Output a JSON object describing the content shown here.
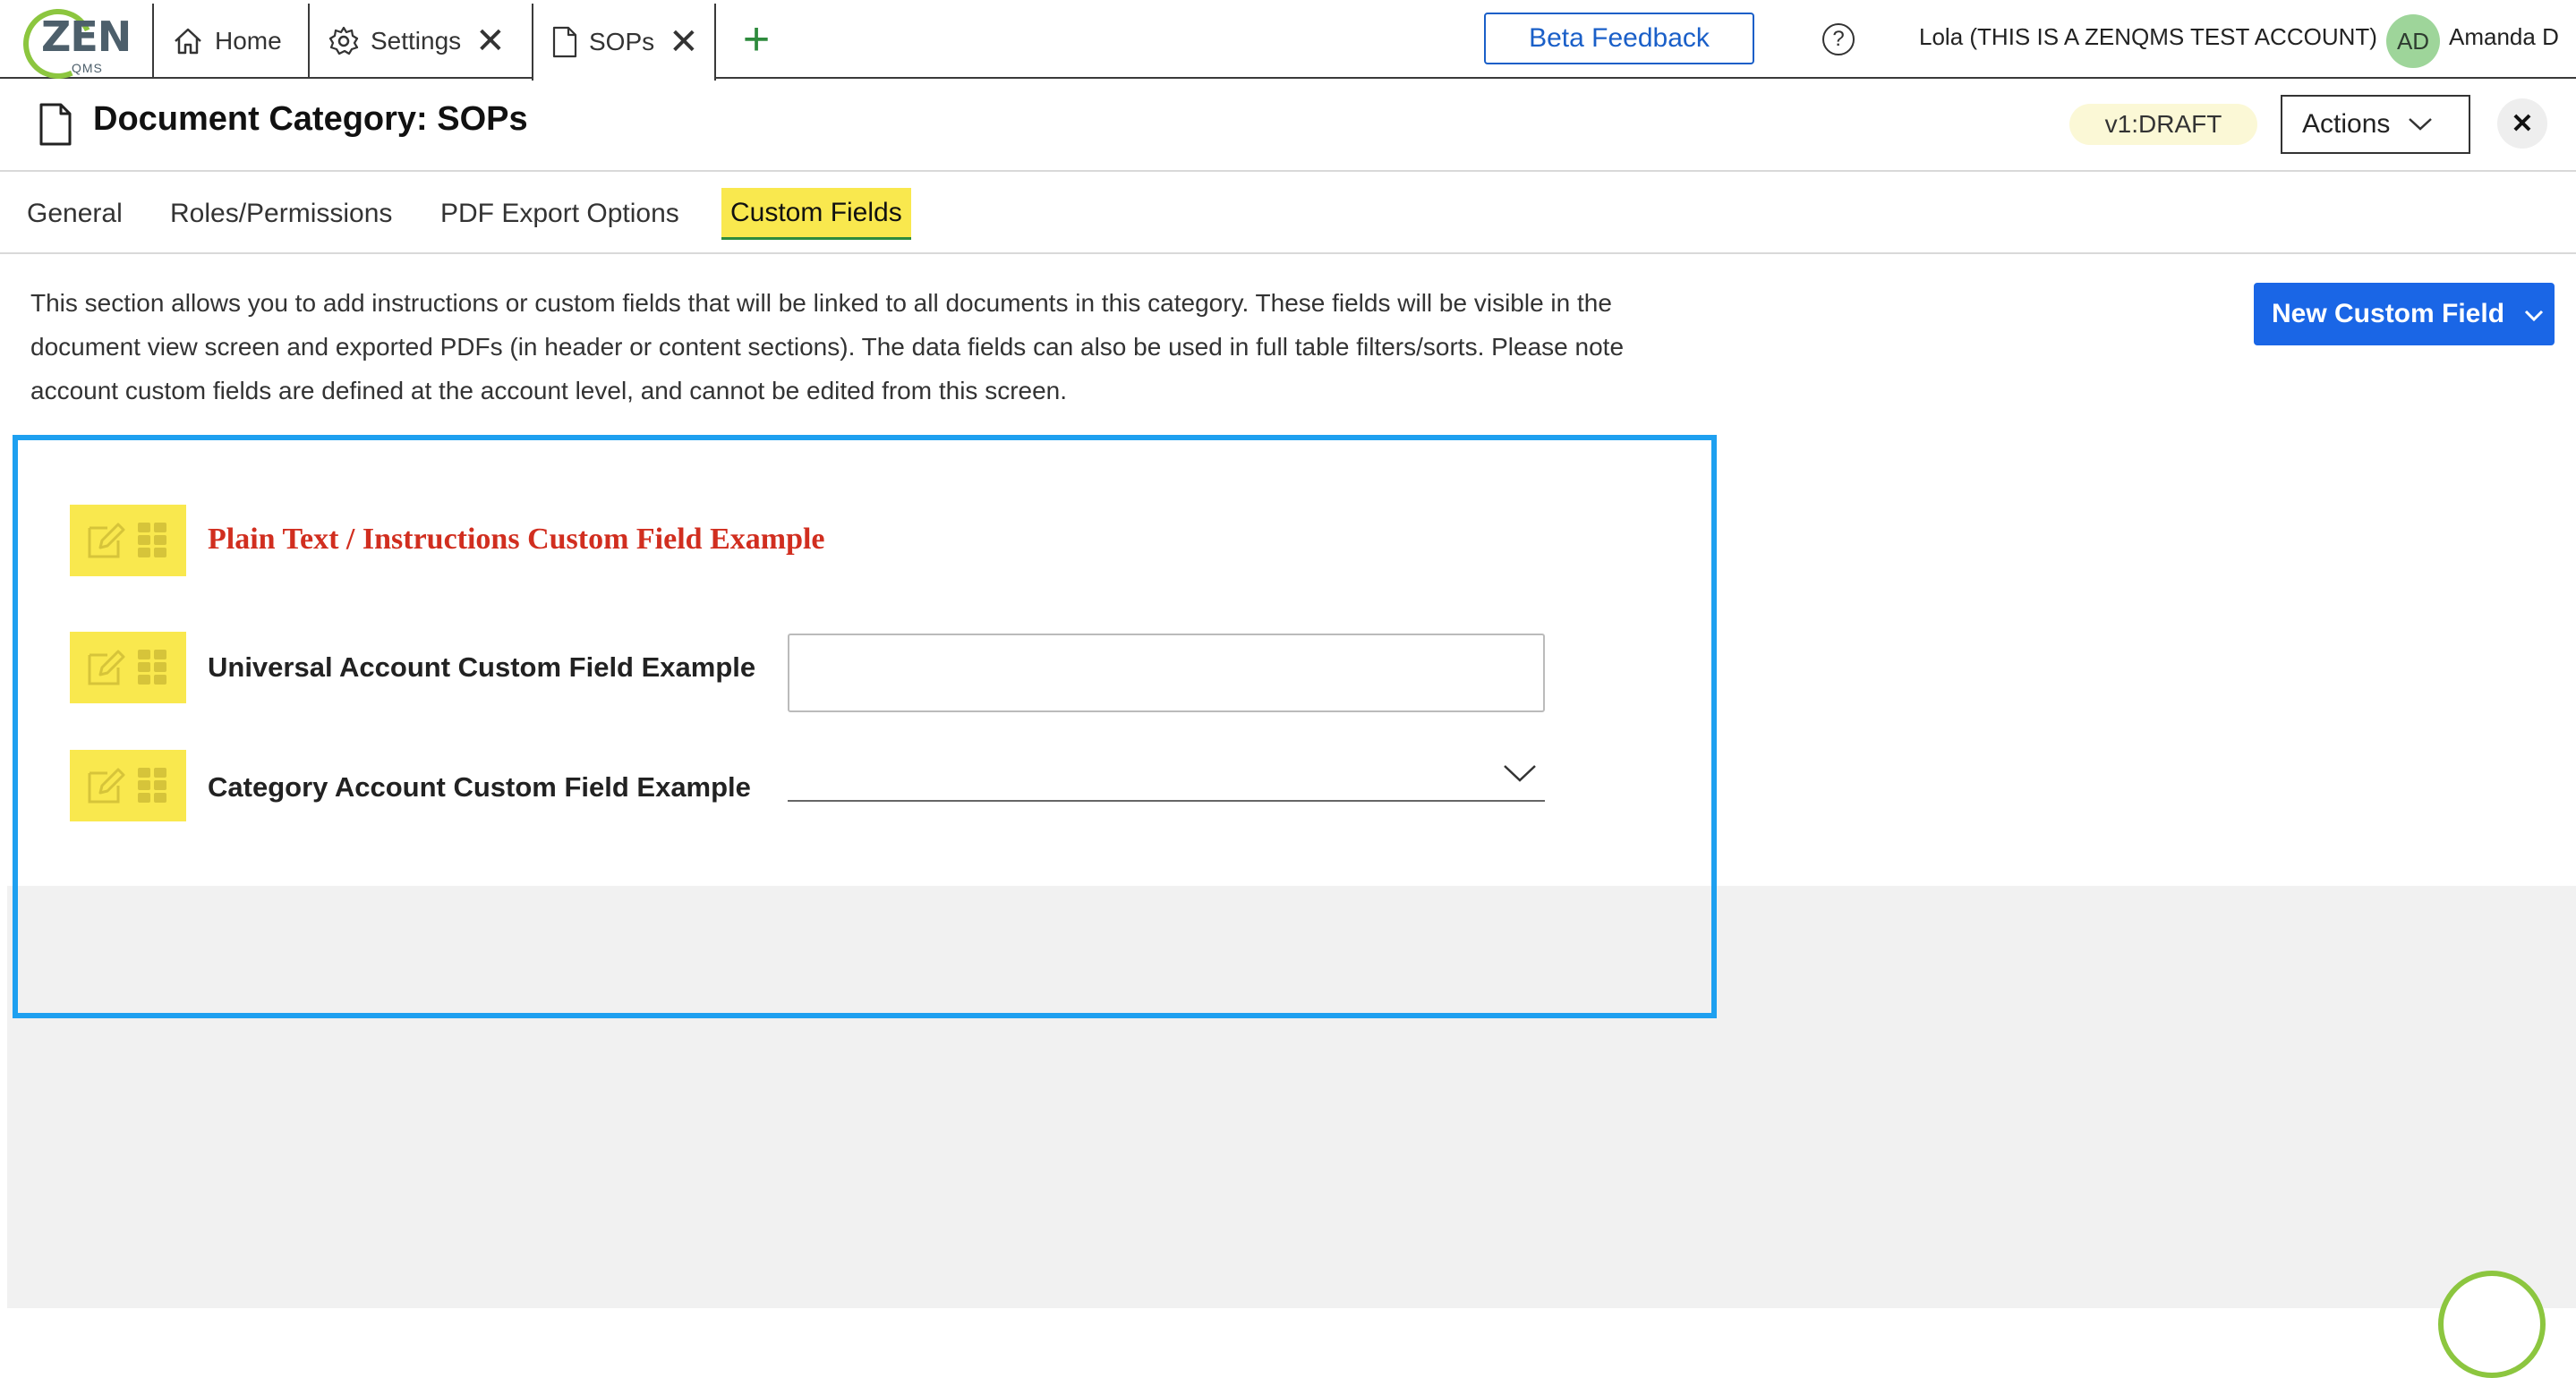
{
  "top_bar": {
    "logo_text": "ZEN",
    "logo_sub": "QMS",
    "tabs": [
      {
        "label": "Home",
        "icon": "home-icon"
      },
      {
        "label": "Settings",
        "icon": "gear-icon",
        "closable": true
      },
      {
        "label": "SOPs",
        "icon": "document-icon",
        "closable": true
      }
    ],
    "add_tab_symbol": "+",
    "close_symbol": "✕",
    "beta_feedback_label": "Beta Feedback",
    "help_symbol": "?",
    "account_name": "Lola (THIS IS A ZENQMS TEST ACCOUNT)",
    "avatar_initials": "AD",
    "user_name": "Amanda D"
  },
  "header": {
    "title": "Document Category: SOPs",
    "version_badge": "v1:DRAFT",
    "actions_label": "Actions",
    "close_symbol": "✕"
  },
  "sub_tabs": [
    {
      "label": "General",
      "active": false
    },
    {
      "label": "Roles/Permissions",
      "active": false
    },
    {
      "label": "PDF Export Options",
      "active": false
    },
    {
      "label": "Custom Fields",
      "active": true
    }
  ],
  "content": {
    "description": "This section allows you to add instructions or custom fields that will be linked to all documents in this category. These fields will be visible in the document view screen and exported PDFs (in header or content sections). The data fields can also be used in full table filters/sorts. Please note account custom fields are defined at the account level, and cannot be edited from this screen.",
    "new_field_label": "New Custom Field",
    "fields": [
      {
        "label": "Plain Text / Instructions Custom Field Example",
        "type": "instructions"
      },
      {
        "label": "Universal Account Custom Field Example",
        "type": "text",
        "value": ""
      },
      {
        "label": "Category Account Custom Field Example",
        "type": "select",
        "value": ""
      }
    ]
  },
  "colors": {
    "highlight": "#f9e84e",
    "primary_blue": "#1a66e6",
    "panel_border": "#1ea0f0",
    "instruction_red": "#d12e1f",
    "brand_green": "#8cc63f"
  }
}
